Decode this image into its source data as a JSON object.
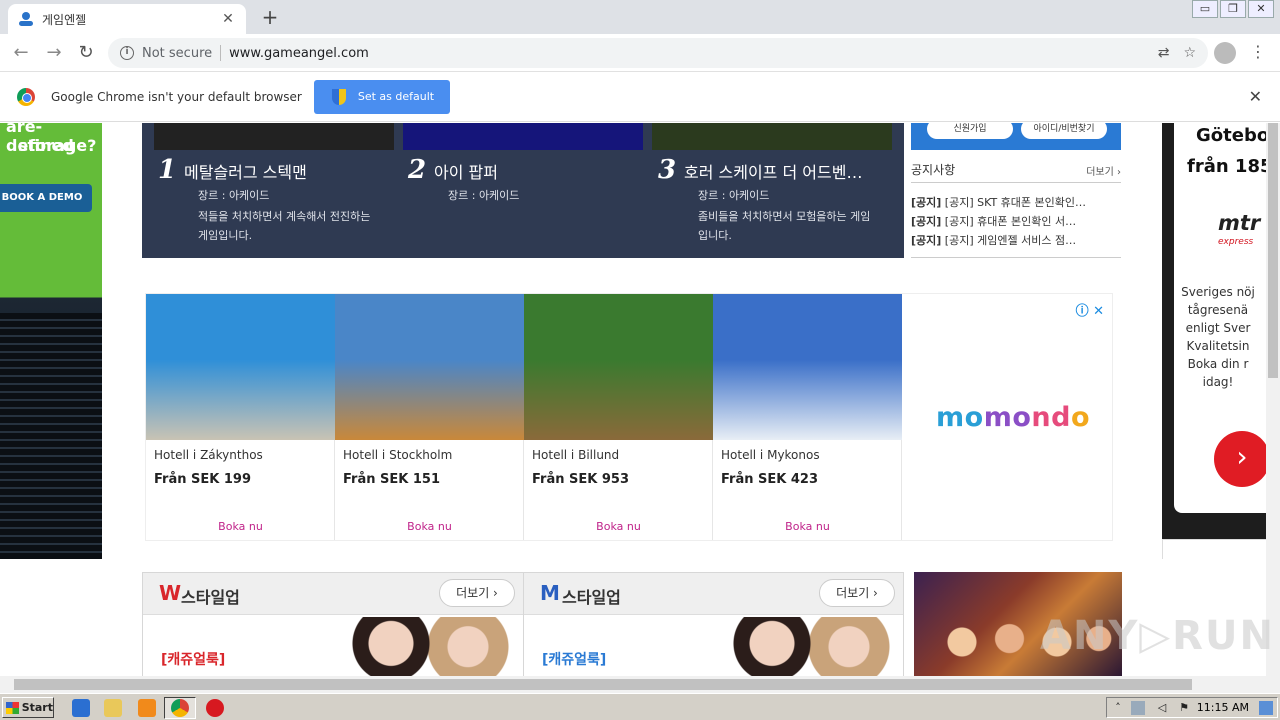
{
  "browser": {
    "tab_title": "게임엔젤",
    "tab_close": "✕",
    "new_tab": "+",
    "window_controls": [
      "▭",
      "❐",
      "✕"
    ],
    "back": "←",
    "forward": "→",
    "reload": "↻",
    "info_glyph": "i",
    "security_label": "Not secure",
    "url": "www.gameangel.com",
    "translate_icon": "⇄",
    "bookmark_icon": "☆",
    "menu_icon": "⋮"
  },
  "infobar": {
    "message": "Google Chrome isn't your default browser",
    "button_label": "Set as default",
    "close": "✕"
  },
  "left_ad": {
    "line1": "are-defined",
    "line2": "storage?",
    "cta": "BOOK A DEMO"
  },
  "ranking": {
    "games": [
      {
        "rank": "1",
        "name": "메탈슬러그 스텍맨",
        "genre": "장르 : 아케이드",
        "desc": "적들을 처치하면서 계속해서 전진하는 게임입니다."
      },
      {
        "rank": "2",
        "name": "아이 팝퍼",
        "genre": "장르 : 아케이드",
        "desc": ""
      },
      {
        "rank": "3",
        "name": "호러 스케이프 더 어드벤…",
        "genre": "장르 : 아케이드",
        "desc": "좀비들을 처치하면서 모험을하는 게임입니다."
      }
    ]
  },
  "notice": {
    "top_buttons": [
      "신원가입",
      "아이디/비번찾기"
    ],
    "title": "공지사항",
    "more": "더보기 ›",
    "items": [
      {
        "tag": "[공지]",
        "text": "[공지] SKT 휴대폰 본인확인…"
      },
      {
        "tag": "[공지]",
        "text": "[공지] 휴대폰 본인확인 서…"
      },
      {
        "tag": "[공지]",
        "text": "[공지] 게임엔젤 서비스 점…"
      }
    ]
  },
  "hotel_ad": {
    "adchoices": "ⓘ ✕",
    "cards": [
      {
        "city": "Hotell i Zákynthos",
        "price": "Från SEK 199",
        "cta": "Boka nu",
        "colors": [
          "#2f8fd8",
          "#c9c3b4"
        ]
      },
      {
        "city": "Hotell i Stockholm",
        "price": "Från SEK 151",
        "cta": "Boka nu",
        "colors": [
          "#4a86c8",
          "#c9883a"
        ]
      },
      {
        "city": "Hotell i Billund",
        "price": "Från SEK 953",
        "cta": "Boka nu",
        "colors": [
          "#3a7a2f",
          "#8a6a3a"
        ]
      },
      {
        "city": "Hotell i Mykonos",
        "price": "Från SEK 423",
        "cta": "Boka nu",
        "colors": [
          "#3a6fc8",
          "#e8eef5"
        ]
      }
    ],
    "brand": [
      "mo",
      "mo",
      "nd",
      "o"
    ]
  },
  "right_ad": {
    "headline1": "Götebo",
    "headline2": "från 185",
    "logo": "mtr",
    "logo_sub": "express",
    "body": "Sveriges nöj tågresenä enligt Sver Kvalitetsin Boka din r idag!",
    "arrow": "›"
  },
  "style_panels": [
    {
      "letter": "W",
      "letter_color": "#d9262b",
      "label": "스타일업",
      "more": "더보기 ›",
      "category": "[캐쥬얼룩]",
      "category_color": "#d9262b"
    },
    {
      "letter": "M",
      "letter_color": "#2a5fc0",
      "label": "스타일업",
      "more": "더보기 ›",
      "category": "[캐쥬얼룩]",
      "category_color": "#2a7ad4"
    }
  ],
  "watermark": "ANY▷RUN",
  "taskbar": {
    "start": "Start",
    "clock": "11:15 AM"
  }
}
